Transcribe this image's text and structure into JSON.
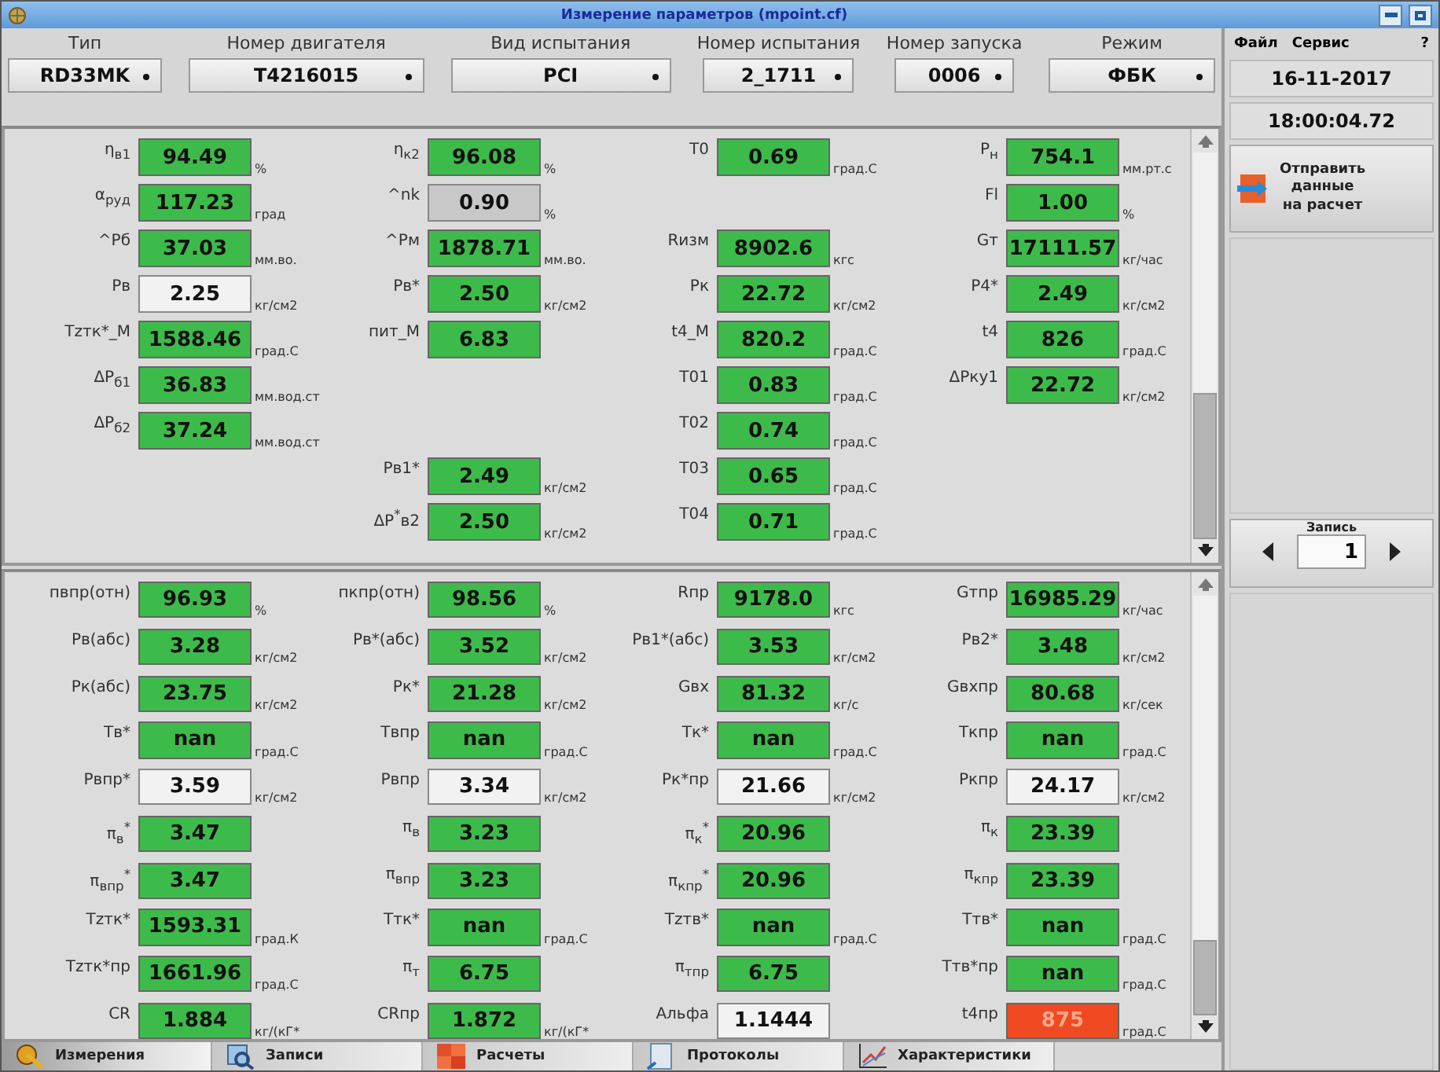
{
  "window": {
    "title": "Измерение параметров (mpoint.cf)"
  },
  "selectors": [
    {
      "label": "Тип",
      "value": "RD33MK"
    },
    {
      "label": "Номер двигателя",
      "value": "T4216015"
    },
    {
      "label": "Вид испытания",
      "value": "PCI"
    },
    {
      "label": "Номер испытания",
      "value": "2_1711"
    },
    {
      "label": "Номер запуска",
      "value": "0006"
    },
    {
      "label": "Режим",
      "value": "ФБК"
    }
  ],
  "upper_panel": {
    "columns": [
      [
        {
          "kind": "field",
          "label": "η$_{в1}$",
          "value": "94.49",
          "unit": "%",
          "color": "#3dbb4a"
        },
        {
          "kind": "field",
          "label": "α$_{руд}$",
          "value": "117.23",
          "unit": "град",
          "color": "#3dbb4a"
        },
        {
          "kind": "field",
          "label": "^Pб",
          "value": "37.03",
          "unit": "мм.во.",
          "color": "#3dbb4a"
        },
        {
          "kind": "field",
          "label": "Рв",
          "value": "2.25",
          "unit": "кг/см2",
          "color": "#f2f2f2"
        },
        {
          "kind": "field",
          "label": "Tzтк*_М",
          "value": "1588.46",
          "unit": "град.С",
          "color": "#3dbb4a"
        },
        {
          "kind": "field",
          "label": "ΔP$_{б1}$",
          "value": "36.83",
          "unit": "мм.вод.ст",
          "color": "#3dbb4a"
        },
        {
          "kind": "field",
          "label": "ΔP$_{б2}$",
          "value": "37.24",
          "unit": "мм.вод.ст",
          "color": "#3dbb4a"
        }
      ],
      [
        {
          "kind": "field",
          "label": "η$_{к2}$",
          "value": "96.08",
          "unit": "%",
          "color": "#3dbb4a"
        },
        {
          "kind": "field",
          "label": "^nk",
          "value": "0.90",
          "unit": "%",
          "color": "#c8c8c8"
        },
        {
          "kind": "field",
          "label": "^Pм",
          "value": "1878.71",
          "unit": "мм.во.",
          "color": "#3dbb4a"
        },
        {
          "kind": "field",
          "label": "Рв*",
          "value": "2.50",
          "unit": "кг/см2",
          "color": "#3dbb4a"
        },
        {
          "kind": "field",
          "label": "пит_М",
          "value": "6.83",
          "color": "#3dbb4a"
        },
        {
          "kind": "blank"
        },
        {
          "kind": "blank"
        },
        {
          "kind": "field",
          "label": "Рв1*",
          "value": "2.49",
          "unit": "кг/см2",
          "color": "#3dbb4a"
        },
        {
          "kind": "field",
          "label": "ΔP$^{*}$в2",
          "value": "2.50",
          "unit": "кг/см2",
          "color": "#3dbb4a"
        }
      ],
      [
        {
          "kind": "field",
          "label": "T0",
          "value": "0.69",
          "unit": "град.С",
          "color": "#3dbb4a"
        },
        {
          "kind": "blank"
        },
        {
          "kind": "field",
          "label": "Rизм",
          "value": "8902.6",
          "unit": "кгс",
          "color": "#3dbb4a"
        },
        {
          "kind": "field",
          "label": "Рк",
          "value": "22.72",
          "unit": "кг/см2",
          "color": "#3dbb4a"
        },
        {
          "kind": "field",
          "label": "t4_М",
          "value": "820.2",
          "unit": "град.С",
          "color": "#3dbb4a"
        },
        {
          "kind": "field",
          "label": "T01",
          "value": "0.83",
          "unit": "град.С",
          "color": "#3dbb4a"
        },
        {
          "kind": "field",
          "label": "T02",
          "value": "0.74",
          "unit": "град.С",
          "color": "#3dbb4a"
        },
        {
          "kind": "field",
          "label": "T03",
          "value": "0.65",
          "unit": "град.С",
          "color": "#3dbb4a"
        },
        {
          "kind": "field",
          "label": "T04",
          "value": "0.71",
          "unit": "град.С",
          "color": "#3dbb4a"
        }
      ],
      [
        {
          "kind": "field",
          "label": "P$_{н}$",
          "value": "754.1",
          "unit": "мм.рт.с",
          "color": "#3dbb4a"
        },
        {
          "kind": "field",
          "label": "Fl",
          "value": "1.00",
          "unit": "%",
          "color": "#3dbb4a"
        },
        {
          "kind": "field",
          "label": "Gт",
          "value": "17111.57",
          "unit": "кг/час",
          "color": "#3dbb4a"
        },
        {
          "kind": "field",
          "label": "Р4*",
          "value": "2.49",
          "unit": "кг/см2",
          "color": "#3dbb4a"
        },
        {
          "kind": "field",
          "label": "t4",
          "value": "826",
          "unit": "град.С",
          "color": "#3dbb4a"
        },
        {
          "kind": "field",
          "label": "ΔPку1",
          "value": "22.72",
          "unit": "кг/см2",
          "color": "#3dbb4a"
        }
      ]
    ]
  },
  "lower_panel": {
    "columns": [
      [
        {
          "kind": "field",
          "label": "пвпр(отн)",
          "value": "96.93",
          "unit": "%",
          "color": "#3dbb4a"
        },
        {
          "kind": "field",
          "label": "Рв(абс)",
          "value": "3.28",
          "unit": "кг/см2",
          "color": "#3dbb4a"
        },
        {
          "kind": "field",
          "label": "Рк(абс)",
          "value": "23.75",
          "unit": "кг/см2",
          "color": "#3dbb4a"
        },
        {
          "kind": "field",
          "label": "Тв*",
          "value": "nan",
          "unit": "град.С",
          "color": "#3dbb4a"
        },
        {
          "kind": "field",
          "label": "Рвпр*",
          "value": "3.59",
          "unit": "кг/см2",
          "color": "#f2f2f2"
        },
        {
          "kind": "field",
          "label": "π$_{в}$$^{*}$",
          "value": "3.47",
          "color": "#3dbb4a"
        },
        {
          "kind": "field",
          "label": "π$_{впр}$$^{*}$",
          "value": "3.47",
          "color": "#3dbb4a"
        },
        {
          "kind": "field",
          "label": "Tzтк*",
          "value": "1593.31",
          "unit": "град.К",
          "color": "#3dbb4a"
        },
        {
          "kind": "field",
          "label": "Tzтк*пр",
          "value": "1661.96",
          "unit": "град.С",
          "color": "#3dbb4a"
        },
        {
          "kind": "field",
          "label": "CR",
          "value": "1.884",
          "unit": "кг/(кГ*",
          "color": "#3dbb4a"
        }
      ],
      [
        {
          "kind": "field",
          "label": "пкпр(отн)",
          "value": "98.56",
          "unit": "%",
          "color": "#3dbb4a"
        },
        {
          "kind": "field",
          "label": "Рв*(абс)",
          "value": "3.52",
          "unit": "кг/см2",
          "color": "#3dbb4a"
        },
        {
          "kind": "field",
          "label": "Рк*",
          "value": "21.28",
          "unit": "кг/см2",
          "color": "#3dbb4a"
        },
        {
          "kind": "field",
          "label": "Твпр",
          "value": "nan",
          "unit": "град.С",
          "color": "#3dbb4a"
        },
        {
          "kind": "field",
          "label": "Рвпр",
          "value": "3.34",
          "unit": "кг/см2",
          "color": "#f2f2f2"
        },
        {
          "kind": "field",
          "label": "π$_{в}$",
          "value": "3.23",
          "color": "#3dbb4a"
        },
        {
          "kind": "field",
          "label": "π$_{впр}$",
          "value": "3.23",
          "color": "#3dbb4a"
        },
        {
          "kind": "field",
          "label": "Ттк*",
          "value": "nan",
          "unit": "град.С",
          "color": "#3dbb4a"
        },
        {
          "kind": "field",
          "label": "π$_{т}$",
          "value": "6.75",
          "color": "#3dbb4a"
        },
        {
          "kind": "field",
          "label": "CRпр",
          "value": "1.872",
          "unit": "кг/(кГ*",
          "color": "#3dbb4a"
        }
      ],
      [
        {
          "kind": "field",
          "label": "Rпр",
          "value": "9178.0",
          "unit": "кгс",
          "color": "#3dbb4a"
        },
        {
          "kind": "field",
          "label": "Рв1*(абс)",
          "value": "3.53",
          "unit": "кг/см2",
          "color": "#3dbb4a"
        },
        {
          "kind": "field",
          "label": "Gвх",
          "value": "81.32",
          "unit": "кг/с",
          "color": "#3dbb4a"
        },
        {
          "kind": "field",
          "label": "Тк*",
          "value": "nan",
          "unit": "град.С",
          "color": "#3dbb4a"
        },
        {
          "kind": "field",
          "label": "Рк*пр",
          "value": "21.66",
          "unit": "кг/см2",
          "color": "#f2f2f2"
        },
        {
          "kind": "field",
          "label": "π$_{к}$$^{*}$",
          "value": "20.96",
          "color": "#3dbb4a"
        },
        {
          "kind": "field",
          "label": "π$_{кпр}$$^{*}$",
          "value": "20.96",
          "color": "#3dbb4a"
        },
        {
          "kind": "field",
          "label": "Tzтв*",
          "value": "nan",
          "unit": "град.С",
          "color": "#3dbb4a"
        },
        {
          "kind": "field",
          "label": "π$_{тпр}$",
          "value": "6.75",
          "color": "#3dbb4a"
        },
        {
          "kind": "field",
          "label": "Альфа",
          "value": "1.1444",
          "color": "#f2f2f2"
        }
      ],
      [
        {
          "kind": "field",
          "label": "Gтпр",
          "value": "16985.29",
          "unit": "кг/час",
          "color": "#3dbb4a"
        },
        {
          "kind": "field",
          "label": "Рв2*",
          "value": "3.48",
          "unit": "кг/см2",
          "color": "#3dbb4a"
        },
        {
          "kind": "field",
          "label": "Gвхпр",
          "value": "80.68",
          "unit": "кг/сек",
          "color": "#3dbb4a"
        },
        {
          "kind": "field",
          "label": "Ткпр",
          "value": "nan",
          "unit": "град.С",
          "color": "#3dbb4a"
        },
        {
          "kind": "field",
          "label": "Ркпр",
          "value": "24.17",
          "unit": "кг/см2",
          "color": "#f2f2f2"
        },
        {
          "kind": "field",
          "label": "π$_{к}$",
          "value": "23.39",
          "color": "#3dbb4a"
        },
        {
          "kind": "field",
          "label": "π$_{кпр}$",
          "value": "23.39",
          "color": "#3dbb4a"
        },
        {
          "kind": "field",
          "label": "Ттв*",
          "value": "nan",
          "unit": "град.С",
          "color": "#3dbb4a"
        },
        {
          "kind": "field",
          "label": "Ттв*пр",
          "value": "nan",
          "unit": "град.С",
          "color": "#3dbb4a"
        },
        {
          "kind": "field",
          "label": "t4пр",
          "value": "875",
          "unit": "град.С",
          "color": "#f04a22"
        }
      ]
    ]
  },
  "tabs": [
    {
      "label": "Измерения",
      "selected": true
    },
    {
      "label": "Записи",
      "selected": false
    },
    {
      "label": "Расчеты",
      "selected": false
    },
    {
      "label": "Протоколы",
      "selected": false
    },
    {
      "label": "Характеристики",
      "selected": false
    }
  ],
  "menu": [
    "Файл",
    "Сервис",
    "?"
  ],
  "date": "16-11-2017",
  "time": "18:00:04.72",
  "send_button": "Отправить\nданные\nна расчет",
  "record": {
    "label": "Запись",
    "value": "1"
  }
}
